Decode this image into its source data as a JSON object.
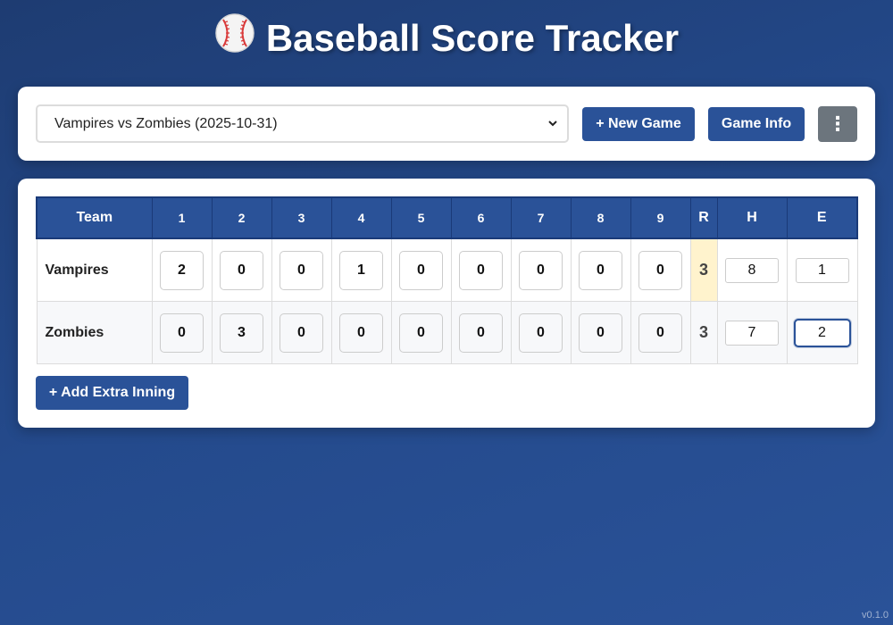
{
  "app": {
    "title": "Baseball Score Tracker",
    "icon": "baseball-icon",
    "version": "v0.1.0"
  },
  "controls": {
    "selected_game": "Vampires vs Zombies (2025-10-31)",
    "new_game_label": "+ New Game",
    "game_info_label": "Game Info",
    "menu_label": "⋮"
  },
  "scoreboard": {
    "headers": {
      "team": "Team",
      "innings": [
        "1",
        "2",
        "3",
        "4",
        "5",
        "6",
        "7",
        "8",
        "9"
      ],
      "runs": "R",
      "hits": "H",
      "errors": "E"
    },
    "rows": [
      {
        "team": "Vampires",
        "innings": [
          "2",
          "0",
          "0",
          "1",
          "0",
          "0",
          "0",
          "0",
          "0"
        ],
        "runs": "3",
        "hits": "8",
        "errors": "1"
      },
      {
        "team": "Zombies",
        "innings": [
          "0",
          "3",
          "0",
          "0",
          "0",
          "0",
          "0",
          "0",
          "0"
        ],
        "runs": "3",
        "hits": "7",
        "errors": "2"
      }
    ],
    "add_inning_label": "+ Add Extra Inning"
  },
  "colors": {
    "primary": "#2a5298",
    "background_top": "#1e3c72",
    "runs_highlight": "#fff3cd",
    "menu_button": "#6c757d"
  }
}
